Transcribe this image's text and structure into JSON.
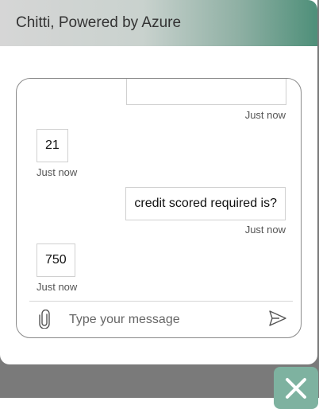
{
  "header": {
    "title": "Chitti, Powered by Azure"
  },
  "messages": [
    {
      "sender": "user",
      "text": "",
      "time": "Just now"
    },
    {
      "sender": "bot",
      "text": "21",
      "time": "Just now"
    },
    {
      "sender": "user",
      "text": "credit scored required is?",
      "time": "Just now"
    },
    {
      "sender": "bot",
      "text": "750",
      "time": "Just now"
    }
  ],
  "input": {
    "placeholder": "Type your message",
    "value": ""
  },
  "icons": {
    "attach": "paperclip-icon",
    "send": "send-icon",
    "close": "close-icon"
  },
  "colors": {
    "accent": "#4e8f79",
    "close_button": "#7eb2a0"
  }
}
